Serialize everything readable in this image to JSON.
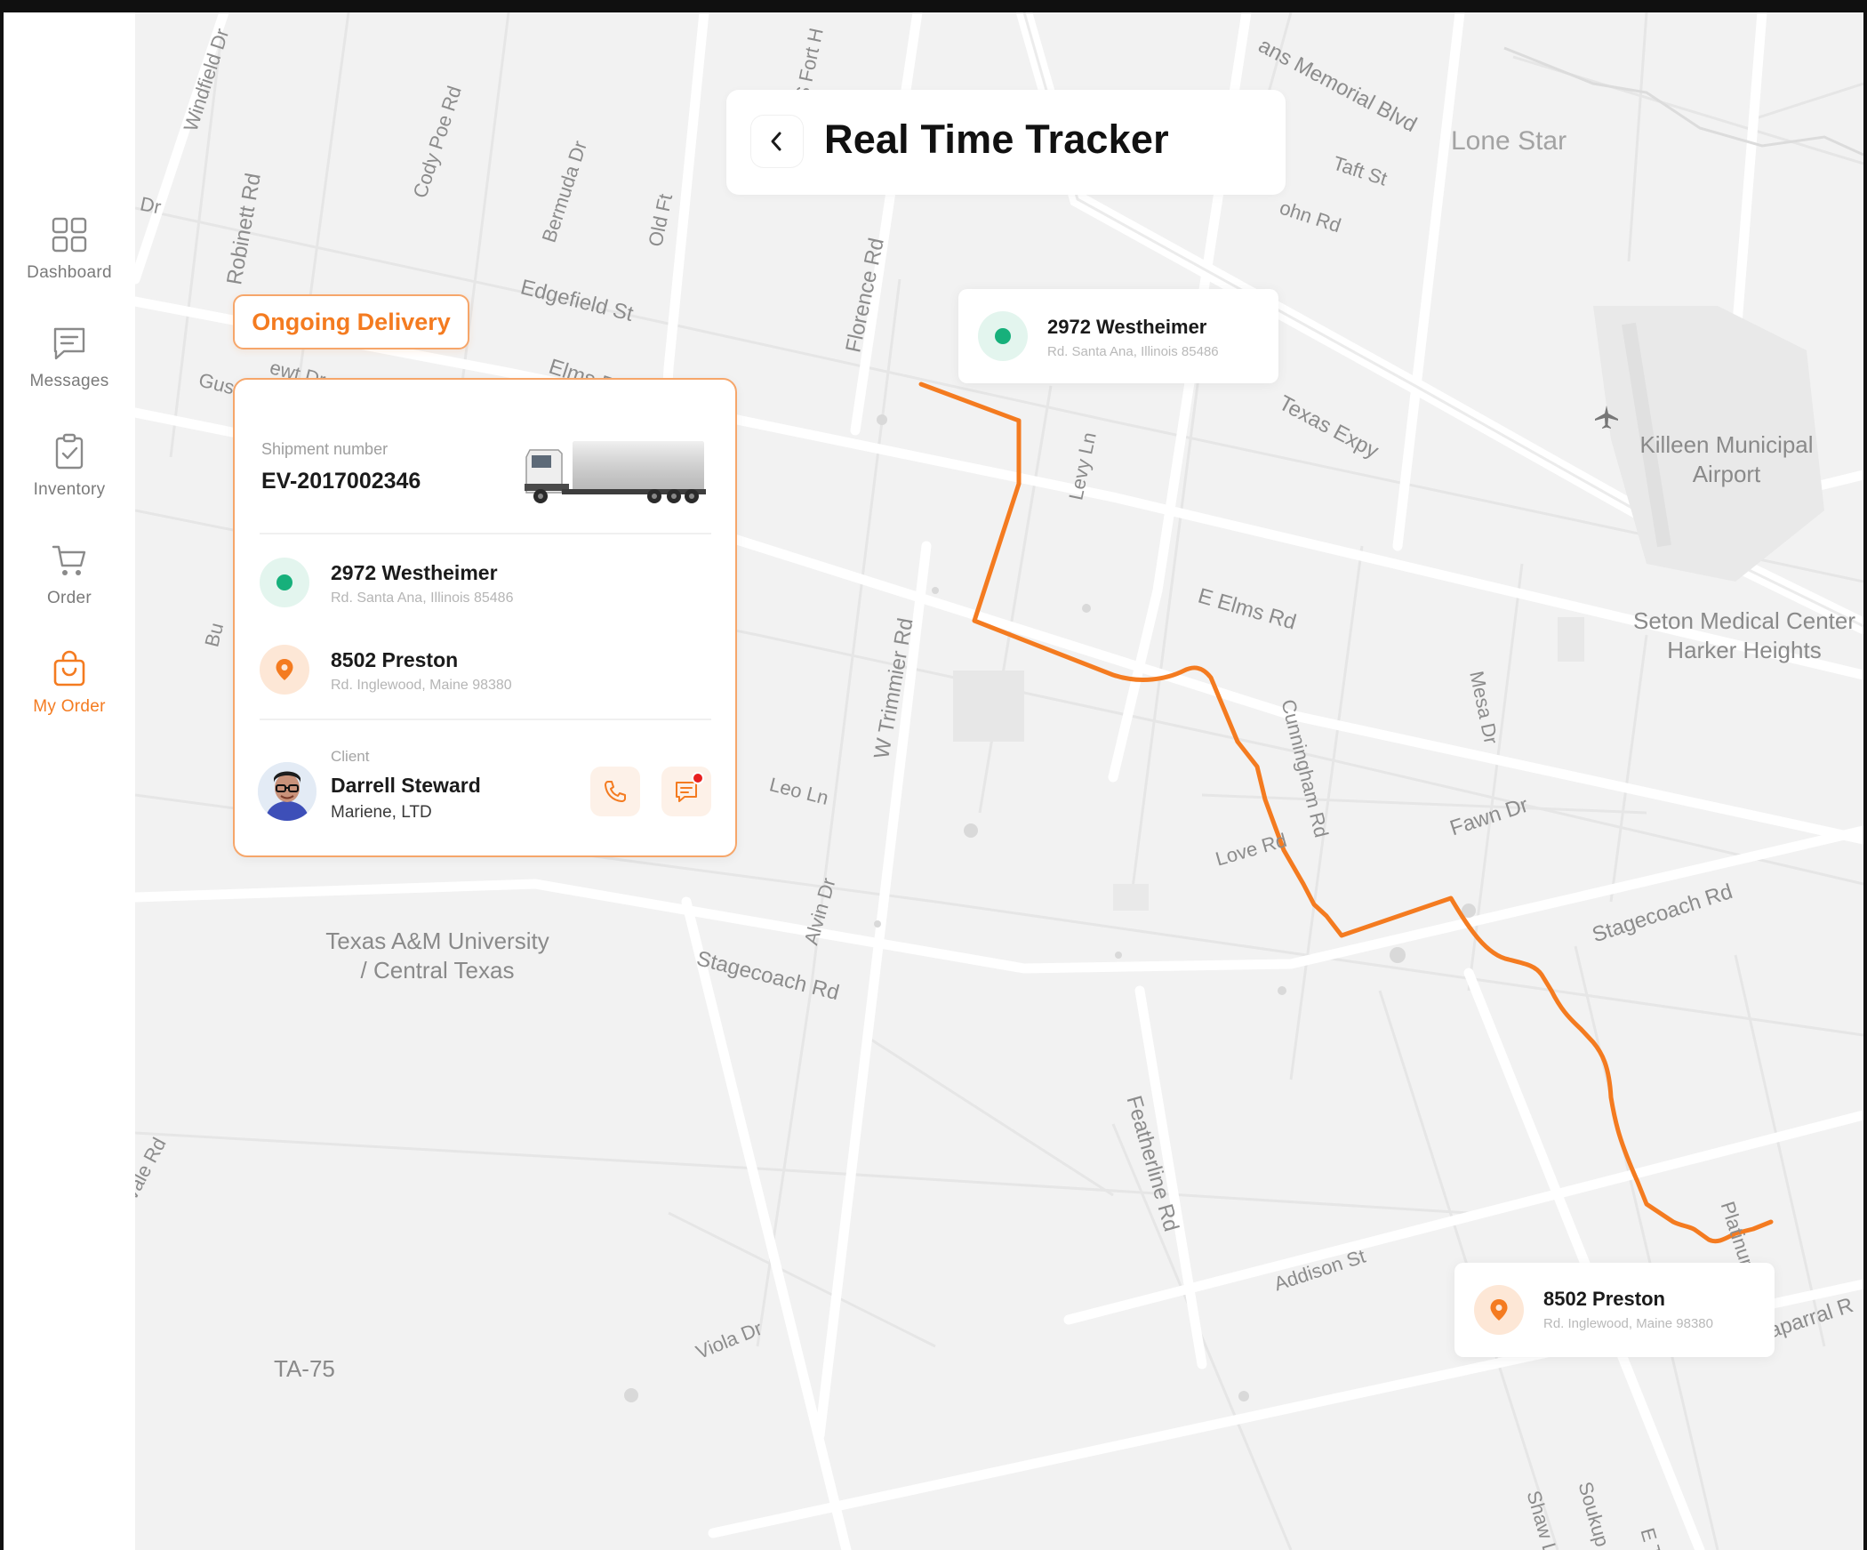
{
  "app": {
    "title": "Real Time Tracker",
    "accent_color": "#f47b20",
    "route_color": "#f47b20",
    "success_color": "#17b07b"
  },
  "sidebar": {
    "items": [
      {
        "label": "Dashboard",
        "icon": "dashboard-grid-icon",
        "active": false
      },
      {
        "label": "Messages",
        "icon": "message-icon",
        "active": false
      },
      {
        "label": "Inventory",
        "icon": "clipboard-check-icon",
        "active": false
      },
      {
        "label": "Order",
        "icon": "cart-icon",
        "active": false
      },
      {
        "label": "My Order",
        "icon": "shopping-bag-icon",
        "active": true
      }
    ]
  },
  "header": {
    "back_icon": "chevron-left-icon",
    "title": "Real Time Tracker"
  },
  "delivery": {
    "status_label": "Ongoing Delivery",
    "shipment_label": "Shipment number",
    "shipment_number": "EV-2017002346",
    "vehicle_icon": "truck-icon",
    "origin": {
      "title": "2972 Westheimer",
      "subtitle": "Rd. Santa Ana, Illinois 85486"
    },
    "destination": {
      "title": "8502 Preston",
      "subtitle": "Rd. Inglewood, Maine 98380"
    },
    "client": {
      "label": "Client",
      "name": "Darrell Steward",
      "company": "Mariene, LTD"
    },
    "actions": {
      "call_icon": "phone-icon",
      "chat_icon": "chat-icon"
    }
  },
  "map": {
    "origin_tag": {
      "title": "2972 Westheimer",
      "subtitle": "Rd. Santa Ana, Illinois 85486"
    },
    "destination_tag": {
      "title": "8502 Preston",
      "subtitle": "Rd. Inglewood, Maine 98380"
    },
    "street_labels": {
      "windfield": "Windfield Dr",
      "cody_poe": "Cody Poe Rd",
      "bermuda": "Bermuda Dr",
      "old_ft": "Old Ft",
      "s_fort": "S Fort H",
      "memorial": "ans Memorial Blvd",
      "taft": "Taft St",
      "john": "ohn Rd",
      "dr": "Dr",
      "robinett": "Robinett Rd",
      "edgefield": "Edgefield St",
      "florence": "Florence Rd",
      "elms_short": "Elms R",
      "newt": "ewt Dr",
      "gus": "Gus R",
      "levy": "Levy Ln",
      "texas_expy": "Texas Expy",
      "e_elms": "E Elms Rd",
      "mesa": "Mesa Dr",
      "cunningham": "Cunningham Rd",
      "w_trimmier": "W Trimmier Rd",
      "leo": "Leo Ln",
      "love": "Love Rd",
      "fawn": "Fawn Dr",
      "alvin": "Alvin Dr",
      "stagecoach_w": "Stagecoach Rd",
      "stagecoach_e": "Stagecoach Rd",
      "featherline": "Featherline Rd",
      "addison": "Addison St",
      "viola": "Viola Dr",
      "platinum": "Platinum",
      "chaparral": "aparral R",
      "vale": "vale Rd",
      "shaw": "Shaw Ln",
      "soukup": "Soukup Ln",
      "e_tri": "E Tri",
      "bu": "Bu",
      "ta75": "TA-75"
    },
    "places": {
      "lone_star": "Lone Star",
      "airport_line1": "Killeen Municipal",
      "airport_line2": "Airport",
      "airport_icon": "airplane-icon",
      "seton_line1": "Seton Medical Center",
      "seton_line2": "Harker Heights",
      "tamu_line1": "Texas A&M University",
      "tamu_line2": "/ Central Texas"
    }
  }
}
